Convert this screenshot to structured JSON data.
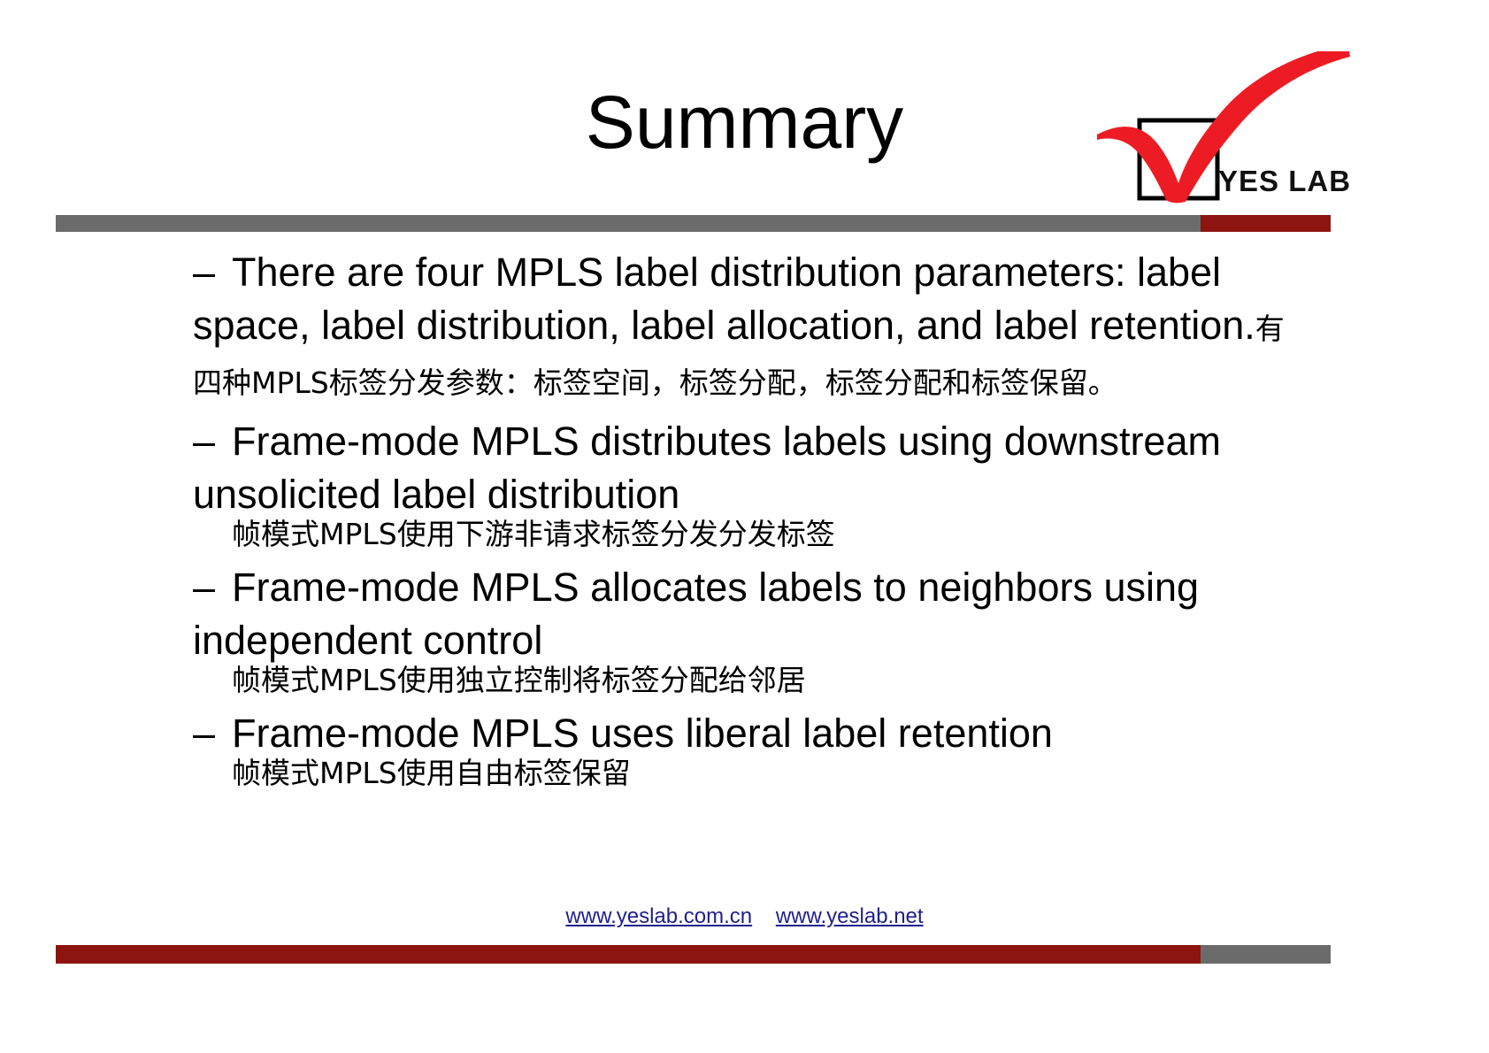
{
  "slide": {
    "title": "Summary",
    "logo": {
      "text": "YES LAB",
      "checkmark_color": "#ED1C24",
      "box_color": "#000000"
    },
    "accent_colors": {
      "grey_bar": "#6b6b6b",
      "red_bar": "#8c1510",
      "link": "#1f1f8f"
    },
    "bullets": [
      {
        "dash": "–",
        "en": "There are four MPLS label distribution parameters: label space, label distribution, label allocation, and label  retention.",
        "zh": "有四种MPLS标签分发参数：标签空间，标签分配，标签分配和标签保留。"
      },
      {
        "dash": "–",
        "en": "Frame-mode MPLS distributes labels using downstream unsolicited label distribution",
        "zh": "帧模式MPLS使用下游非请求标签分发分发标签"
      },
      {
        "dash": "–",
        "en": "Frame-mode MPLS allocates labels to neighbors using independent control",
        "zh": "帧模式MPLS使用独立控制将标签分配给邻居"
      },
      {
        "dash": "–",
        "en": "Frame-mode MPLS uses liberal label retention",
        "zh": "帧模式MPLS使用自由标签保留"
      }
    ],
    "footer": {
      "link1": "www.yeslab.com.cn",
      "link2": "www.yeslab.net"
    }
  }
}
